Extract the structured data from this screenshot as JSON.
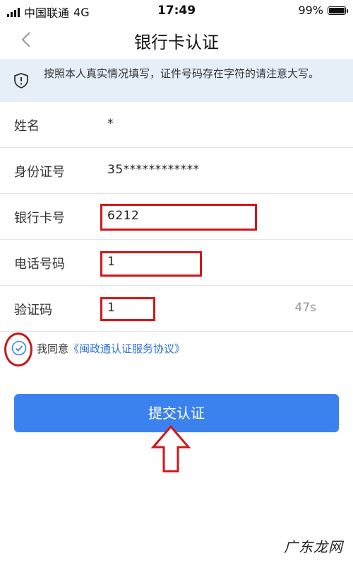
{
  "status_bar": {
    "carrier": "中国联通",
    "network": "4G",
    "time": "17:49",
    "battery": "99%",
    "battery_level": 0.99
  },
  "nav": {
    "title": "银行卡认证",
    "back_icon": "chevron-left-icon"
  },
  "notice": {
    "icon": "shield-icon",
    "text": "按照本人真实情况填写，证件号码存在字符的请注意大写。"
  },
  "form": {
    "rows": [
      {
        "label": "姓名",
        "value": "*"
      },
      {
        "label": "身份证号",
        "value": "35************"
      },
      {
        "label": "银行卡号",
        "value": "6212"
      },
      {
        "label": "电话号码",
        "value": "1"
      },
      {
        "label": "验证码",
        "value": "1",
        "timer": "47s"
      }
    ]
  },
  "agreement": {
    "prefix": "我同意",
    "link": "《闽政通认证服务协议》",
    "checked": true
  },
  "submit": {
    "label": "提交认证"
  },
  "watermark": "广东龙网",
  "colors": {
    "accent": "#3c82ee",
    "notice_bg": "#e6eef8",
    "annotation_red": "#d01818",
    "link": "#2b6fd6"
  }
}
